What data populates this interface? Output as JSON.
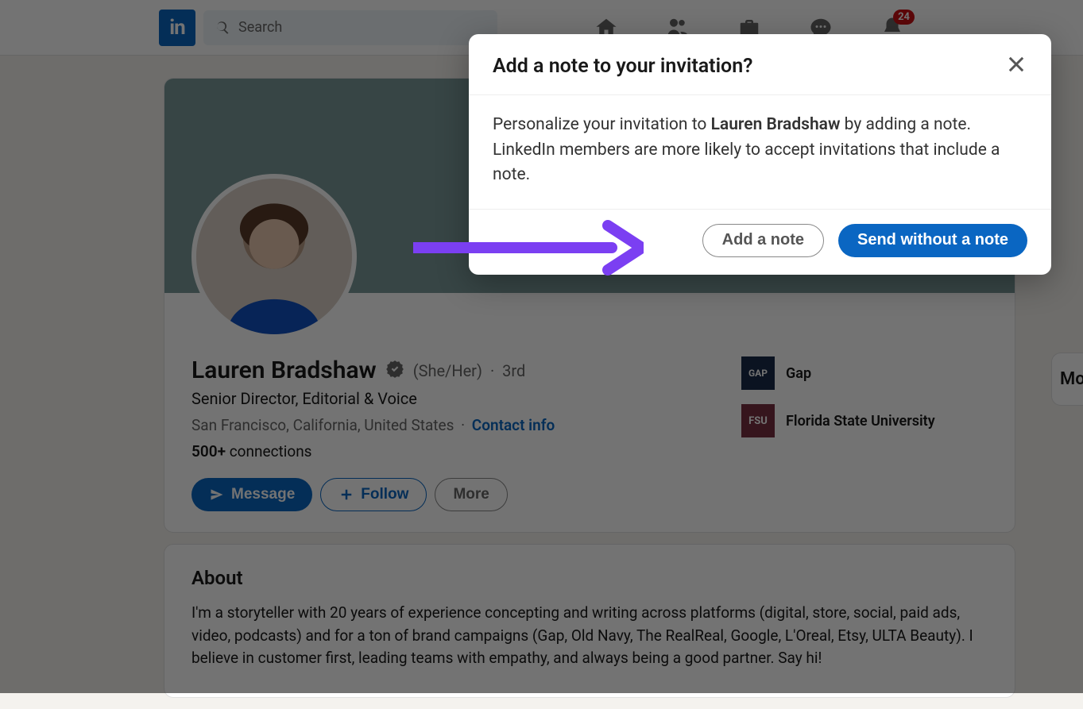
{
  "nav": {
    "search_placeholder": "Search",
    "notification_badge": "24"
  },
  "profile": {
    "name": "Lauren Bradshaw",
    "pronouns": "(She/Her)",
    "degree_sep": "·",
    "degree": "3rd",
    "headline": "Senior Director, Editorial & Voice",
    "location": "San Francisco, California, United States",
    "loc_sep": "·",
    "contact_link": "Contact info",
    "connections_strong": "500+",
    "connections_rest": " connections",
    "message_btn": "Message",
    "follow_btn": "Follow",
    "more_btn": "More",
    "orgs": {
      "company_label": "GAP",
      "company_name": "Gap",
      "school_label": "FSU",
      "school_name": "Florida State University"
    }
  },
  "about": {
    "heading": "About",
    "text": "I'm a storyteller with 20 years of experience concepting and writing across platforms (digital, store, social, paid ads, video, podcasts) and for a ton of brand campaigns (Gap, Old Navy, The RealReal, Google, L'Oreal, Etsy, ULTA Beauty). I believe in customer first, leading teams with empathy, and always being a good partner. Say hi!"
  },
  "sidebar": {
    "more_heading": "Mo"
  },
  "modal": {
    "title": "Add a note to your invitation?",
    "body_before": "Personalize your invitation to ",
    "body_name": "Lauren Bradshaw",
    "body_after": " by adding a note. LinkedIn members are more likely to accept invitations that include a note.",
    "add_note_btn": "Add a note",
    "send_btn": "Send without a note"
  }
}
